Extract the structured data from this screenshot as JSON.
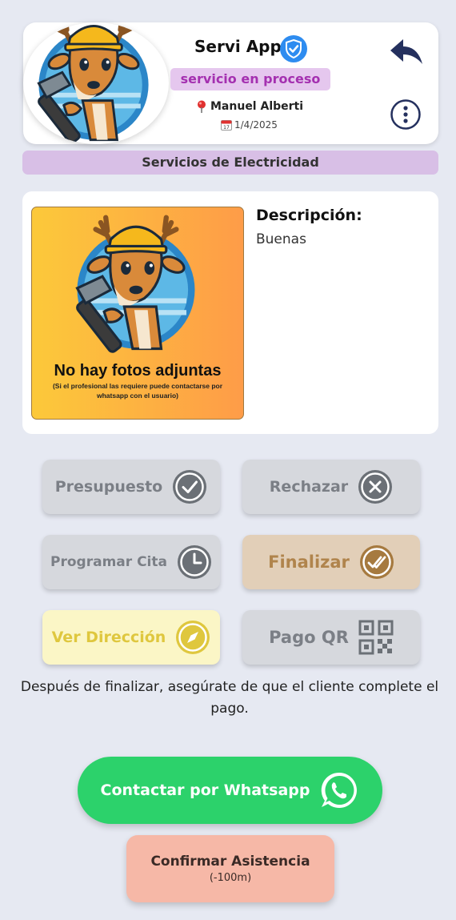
{
  "header": {
    "app_title": "Servi App",
    "status": "servicio en proceso",
    "person": "Manuel Alberti",
    "date": "1/4/2025",
    "icons": [
      "verified-icon",
      "pin-icon",
      "calendar-icon",
      "back-arrow-icon",
      "more-options-icon"
    ]
  },
  "category": "Servicios de Electricidad",
  "details": {
    "photo_placeholder_title": "No hay fotos adjuntas",
    "photo_placeholder_note": "(Si el profesional las requiere puede contactarse por whatsapp con el usuario)",
    "description_label": "Descripción:",
    "description_text": "Buenas"
  },
  "actions": {
    "presupuesto": "Presupuesto",
    "rechazar": "Rechazar",
    "programar_cita": "Programar Cita",
    "finalizar": "Finalizar",
    "ver_direccion": "Ver Dirección",
    "pago_qr": "Pago QR"
  },
  "note": "Después de finalizar, asegúrate de que el cliente complete el pago.",
  "whatsapp_button": "Contactar por Whatsapp",
  "confirm": {
    "label": "Confirmar Asistencia",
    "sub": "(-100m)"
  },
  "colors": {
    "background": "#e6e9f2",
    "status_pill": "#e5c7ee",
    "status_text": "#a430b0",
    "category_bar": "#d8bfe6",
    "whatsapp": "#2cd26b",
    "confirm": "#f6b8a7",
    "finalizar": "#e2cfb8",
    "ver_direccion": "#fbf6c6",
    "grey_button": "#d6d8dd"
  }
}
